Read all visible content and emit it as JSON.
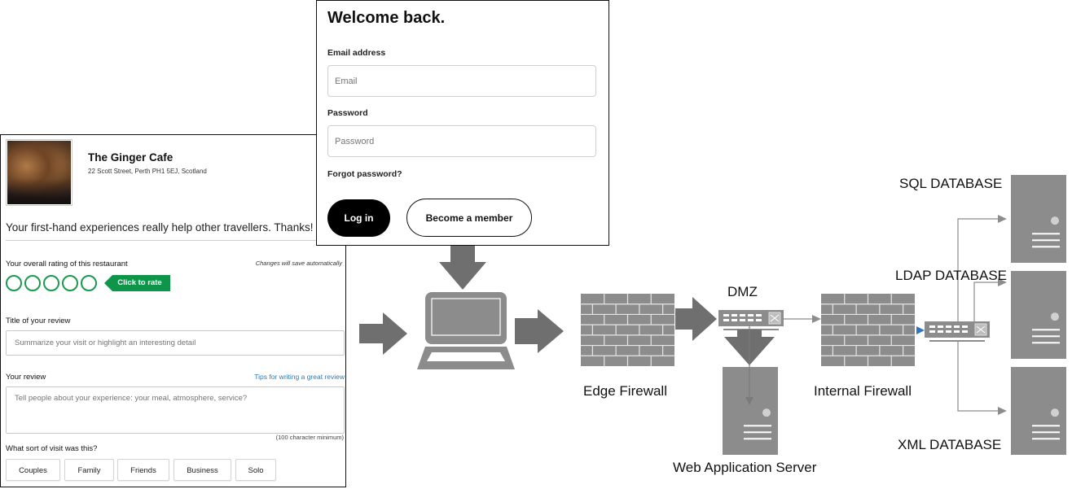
{
  "review_form": {
    "restaurant_name": "The Ginger Cafe",
    "address": "22 Scott Street, Perth PH1 5EJ, Scotland",
    "thanks_message": "Your first-hand experiences really help other travellers. Thanks!",
    "rating_label": "Your overall rating of this restaurant",
    "autosave_note": "Changes will save automatically",
    "rating": {
      "value": 0,
      "max": 5
    },
    "click_to_rate_label": "Click to rate",
    "title_label": "Title of your review",
    "title_placeholder": "Summarize your visit or highlight an interesting detail",
    "review_label": "Your review",
    "tips_link": "Tips for writing a great review",
    "review_placeholder": "Tell people about your experience: your meal, atmosphere, service?",
    "char_minimum_note": "(100 character minimum)",
    "visit_type_label": "What sort of visit was this?",
    "visit_types": [
      "Couples",
      "Family",
      "Friends",
      "Business",
      "Solo"
    ],
    "accent_color": "#0f9549"
  },
  "login": {
    "title": "Welcome back.",
    "email_label": "Email address",
    "email_placeholder": "Email",
    "password_label": "Password",
    "password_placeholder": "Password",
    "forgot_password": "Forgot password?",
    "login_button": "Log in",
    "member_button": "Become a member"
  },
  "diagram": {
    "nodes": {
      "client": {
        "icon": "laptop-icon"
      },
      "edge_firewall": {
        "label": "Edge Firewall",
        "icon": "brick-wall-icon"
      },
      "dmz": {
        "label": "DMZ",
        "icon": "network-switch-icon"
      },
      "web_server": {
        "label": "Web Application Server",
        "icon": "server-icon"
      },
      "internal_firewall": {
        "label": "Internal Firewall",
        "icon": "brick-wall-icon"
      },
      "internal_switch": {
        "icon": "network-switch-icon"
      },
      "sql_db": {
        "label": "SQL DATABASE",
        "icon": "server-icon"
      },
      "ldap_db": {
        "label": "LDAP DATABASE",
        "icon": "server-icon"
      },
      "xml_db": {
        "label": "XML DATABASE",
        "icon": "server-icon"
      }
    },
    "colors": {
      "icon_gray": "#8c8c8c",
      "arrow_gray": "#6f6f6f",
      "connector_blue": "#2e75c4"
    }
  }
}
